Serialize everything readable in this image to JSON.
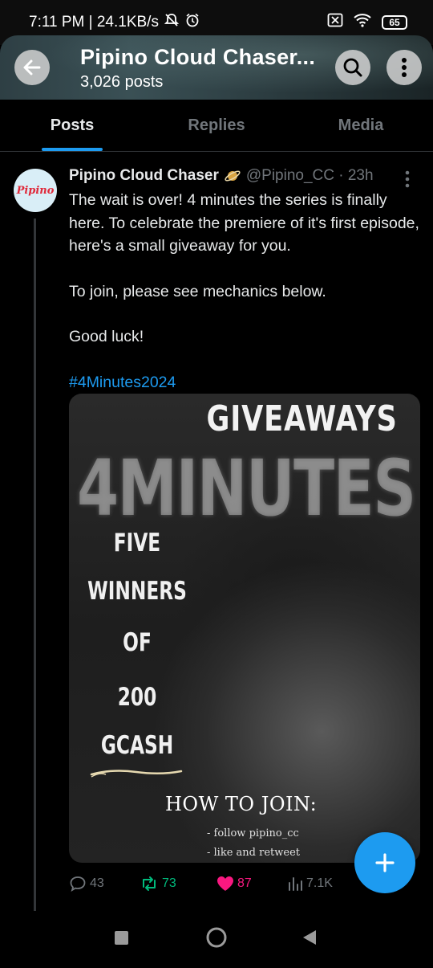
{
  "status_bar": {
    "time_speed": "7:11 PM | 24.1KB/s",
    "battery": "65"
  },
  "header": {
    "title": "Pipino Cloud Chaser...",
    "posts_count": "3,026 posts"
  },
  "tabs": [
    {
      "label": "Posts",
      "active": true
    },
    {
      "label": "Replies",
      "active": false
    },
    {
      "label": "Media",
      "active": false
    }
  ],
  "post": {
    "avatar_text": "Pipino",
    "author": "Pipino Cloud Chaser",
    "handle_time": "@Pipino_CC · 23h",
    "body_lines": [
      "The wait is over! 4 minutes the series is finally here. To celebrate the premiere of it's first episode, here's a small giveaway for you.",
      "To join, please see mechanics below.",
      "Good luck!"
    ],
    "hashtag": "#4Minutes2024",
    "media": {
      "title": "GIVEAWAYS",
      "big_text": "4MINUTES",
      "stack": [
        "FIVE",
        "WINNERS",
        "OF",
        "200",
        "GCASH"
      ],
      "how_to_join": "HOW TO JOIN:",
      "steps": [
        "- follow pipino_cc",
        "- like and retweet"
      ]
    },
    "stats": {
      "replies": "43",
      "reposts": "73",
      "likes": "87",
      "views": "7.1K"
    }
  },
  "colors": {
    "accent": "#1d9bf0",
    "repost": "#00ba7c",
    "like": "#f91880"
  }
}
